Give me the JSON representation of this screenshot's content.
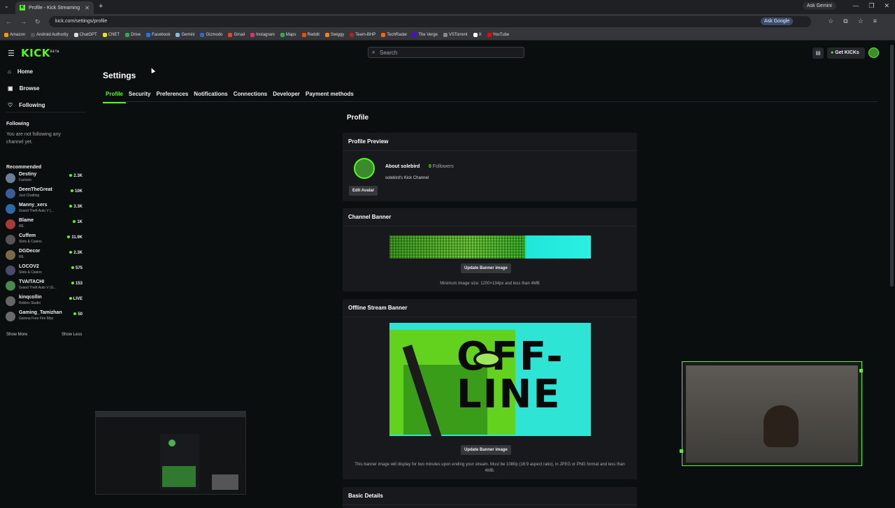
{
  "browser": {
    "tab_title": "Profile - Kick Streaming",
    "url": "kick.com/settings/profile",
    "ask_gemini": "Ask Gemini",
    "ask_google": "Ask Google",
    "bookmarks": [
      {
        "label": "Amazon",
        "color": "#ff9900"
      },
      {
        "label": "Android Authority",
        "color": "#555555"
      },
      {
        "label": "ChatGPT",
        "color": "#dddddd"
      },
      {
        "label": "CNET",
        "color": "#e8e800"
      },
      {
        "label": "Drive",
        "color": "#34a853"
      },
      {
        "label": "Facebook",
        "color": "#1877f2"
      },
      {
        "label": "Gemini",
        "color": "#8ab4f8"
      },
      {
        "label": "Gizmodo",
        "color": "#3366cc"
      },
      {
        "label": "Gmail",
        "color": "#ea4335"
      },
      {
        "label": "Instagram",
        "color": "#e1306c"
      },
      {
        "label": "Maps",
        "color": "#34a853"
      },
      {
        "label": "Reddit",
        "color": "#ff4500"
      },
      {
        "label": "Swiggy",
        "color": "#fc8019"
      },
      {
        "label": "Team-BHP",
        "color": "#b22222"
      },
      {
        "label": "TechRadar",
        "color": "#ff6600"
      },
      {
        "label": "The Verge",
        "color": "#5200ff"
      },
      {
        "label": "VSTorrent",
        "color": "#888888"
      },
      {
        "label": "X",
        "color": "#ffffff"
      },
      {
        "label": "YouTube",
        "color": "#ff0000"
      }
    ]
  },
  "header": {
    "logo": "KICK",
    "logo_badge": "BETA",
    "search_placeholder": "Search",
    "get_kicks": "Get KICKs"
  },
  "sidebar": {
    "nav": [
      {
        "label": "Home"
      },
      {
        "label": "Browse"
      },
      {
        "label": "Following"
      }
    ],
    "following_heading": "Following",
    "following_empty": "You are not following any channel yet.",
    "recommended_heading": "Recommended",
    "recommended": [
      {
        "name": "Destiny",
        "game": "Factorio",
        "viewers": "2.3K"
      },
      {
        "name": "DeenTheGreat",
        "game": "Just Chatting",
        "viewers": "10K"
      },
      {
        "name": "Manny_xers",
        "game": "Grand Theft Auto V (...",
        "viewers": "3.3K"
      },
      {
        "name": "Blame",
        "game": "IRL",
        "viewers": "1K"
      },
      {
        "name": "Cuffem",
        "game": "Slots & Casino",
        "viewers": "11.9K"
      },
      {
        "name": "DGDecor",
        "game": "IRL",
        "viewers": "2.3K"
      },
      {
        "name": "LOCOV2",
        "game": "Slots & Casino",
        "viewers": "575"
      },
      {
        "name": "TVAITACHI",
        "game": "Grand Theft Auto V (G...",
        "viewers": "153"
      },
      {
        "name": "kinqcollin",
        "game": "Roblox Studio",
        "viewers": "LIVE"
      },
      {
        "name": "Gaming_Tamizhan",
        "game": "Garena Free Fire Max",
        "viewers": "50"
      }
    ],
    "show_more": "Show More",
    "show_less": "Show Less"
  },
  "settings": {
    "title": "Settings",
    "tabs": [
      "Profile",
      "Security",
      "Preferences",
      "Notifications",
      "Connections",
      "Developer",
      "Payment methods"
    ],
    "section_title": "Profile",
    "profile_preview": {
      "heading": "Profile Preview",
      "about": "About solebird",
      "followers_count": "0",
      "followers_label": "Followers",
      "channel_name": "solebird's Kick Channel",
      "edit_avatar": "Edit Avatar"
    },
    "channel_banner": {
      "heading": "Channel Banner",
      "button": "Update Banner image",
      "note": "Minimum image size: 1200×134px and less than 4MB"
    },
    "offline_banner": {
      "heading": "Offline Stream Banner",
      "image_text": "OFF-LINE",
      "button": "Update Banner image",
      "note": "This banner image will display for two minutes upon ending your stream. Must be 1080p (16:9 aspect ratio), in JPEG or PNG format and less than 4MB."
    },
    "basic_details": {
      "heading": "Basic Details"
    }
  },
  "colors": {
    "accent": "#53fc18",
    "background": "#0b0e0f",
    "card": "#17191c"
  }
}
